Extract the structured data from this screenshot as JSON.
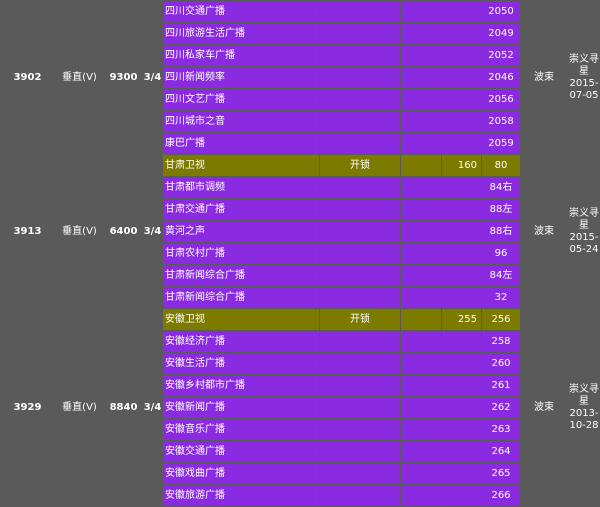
{
  "groups": [
    {
      "freq": "3902",
      "polarity": "垂直(V)",
      "symbol_rate": "9300",
      "fec": "3/4",
      "beam": "波束",
      "source_date": "崇义寻星2015-07-05",
      "channels": [
        {
          "name": "四川交通广播",
          "system": "",
          "sid": "",
          "vpid": "",
          "apid": "2050"
        },
        {
          "name": "四川旅游生活广播",
          "system": "",
          "sid": "",
          "vpid": "",
          "apid": "2049"
        },
        {
          "name": "四川私家车广播",
          "system": "",
          "sid": "",
          "vpid": "",
          "apid": "2052"
        },
        {
          "name": "四川新闻频率",
          "system": "",
          "sid": "",
          "vpid": "",
          "apid": "2046"
        },
        {
          "name": "四川文艺广播",
          "system": "",
          "sid": "",
          "vpid": "",
          "apid": "2056"
        },
        {
          "name": "四川城市之音",
          "system": "",
          "sid": "",
          "vpid": "",
          "apid": "2058"
        },
        {
          "name": "康巴广播",
          "system": "",
          "sid": "",
          "vpid": "",
          "apid": "2059"
        }
      ]
    },
    {
      "freq": "3913",
      "polarity": "垂直(V)",
      "symbol_rate": "6400",
      "fec": "3/4",
      "beam": "波束",
      "source_date": "崇义寻星2015-05-24",
      "channels": [
        {
          "name": "甘肃卫视",
          "system": "开锁",
          "sid": "",
          "vpid": "160",
          "apid": "80",
          "highlight": true
        },
        {
          "name": "甘肃都市调频",
          "system": "",
          "sid": "",
          "vpid": "",
          "apid": "84右"
        },
        {
          "name": "甘肃交通广播",
          "system": "",
          "sid": "",
          "vpid": "",
          "apid": "88左"
        },
        {
          "name": "黄河之声",
          "system": "",
          "sid": "",
          "vpid": "",
          "apid": "88右"
        },
        {
          "name": "甘肃农村广播",
          "system": "",
          "sid": "",
          "vpid": "",
          "apid": "96"
        },
        {
          "name": "甘肃新闻综合广播",
          "system": "",
          "sid": "",
          "vpid": "",
          "apid": "84左"
        },
        {
          "name": "甘肃新闻综合广播",
          "system": "",
          "sid": "",
          "vpid": "",
          "apid": "32"
        }
      ]
    },
    {
      "freq": "3929",
      "polarity": "垂直(V)",
      "symbol_rate": "8840",
      "fec": "3/4",
      "beam": "波束",
      "source_date": "崇义寻星2013-10-28",
      "channels": [
        {
          "name": "安徽卫视",
          "system": "开锁",
          "sid": "",
          "vpid": "255",
          "apid": "256",
          "highlight": true
        },
        {
          "name": "安徽经济广播",
          "system": "",
          "sid": "",
          "vpid": "",
          "apid": "258"
        },
        {
          "name": "安徽生活广播",
          "system": "",
          "sid": "",
          "vpid": "",
          "apid": "260"
        },
        {
          "name": "安徽乡村都市广播",
          "system": "",
          "sid": "",
          "vpid": "",
          "apid": "261"
        },
        {
          "name": "安徽新闻广播",
          "system": "",
          "sid": "",
          "vpid": "",
          "apid": "262"
        },
        {
          "name": "安徽音乐广播",
          "system": "",
          "sid": "",
          "vpid": "",
          "apid": "263"
        },
        {
          "name": "安徽交通广播",
          "system": "",
          "sid": "",
          "vpid": "",
          "apid": "264"
        },
        {
          "name": "安徽戏曲广播",
          "system": "",
          "sid": "",
          "vpid": "",
          "apid": "265"
        },
        {
          "name": "安徽旅游广播",
          "system": "",
          "sid": "",
          "vpid": "",
          "apid": "266"
        }
      ]
    }
  ]
}
